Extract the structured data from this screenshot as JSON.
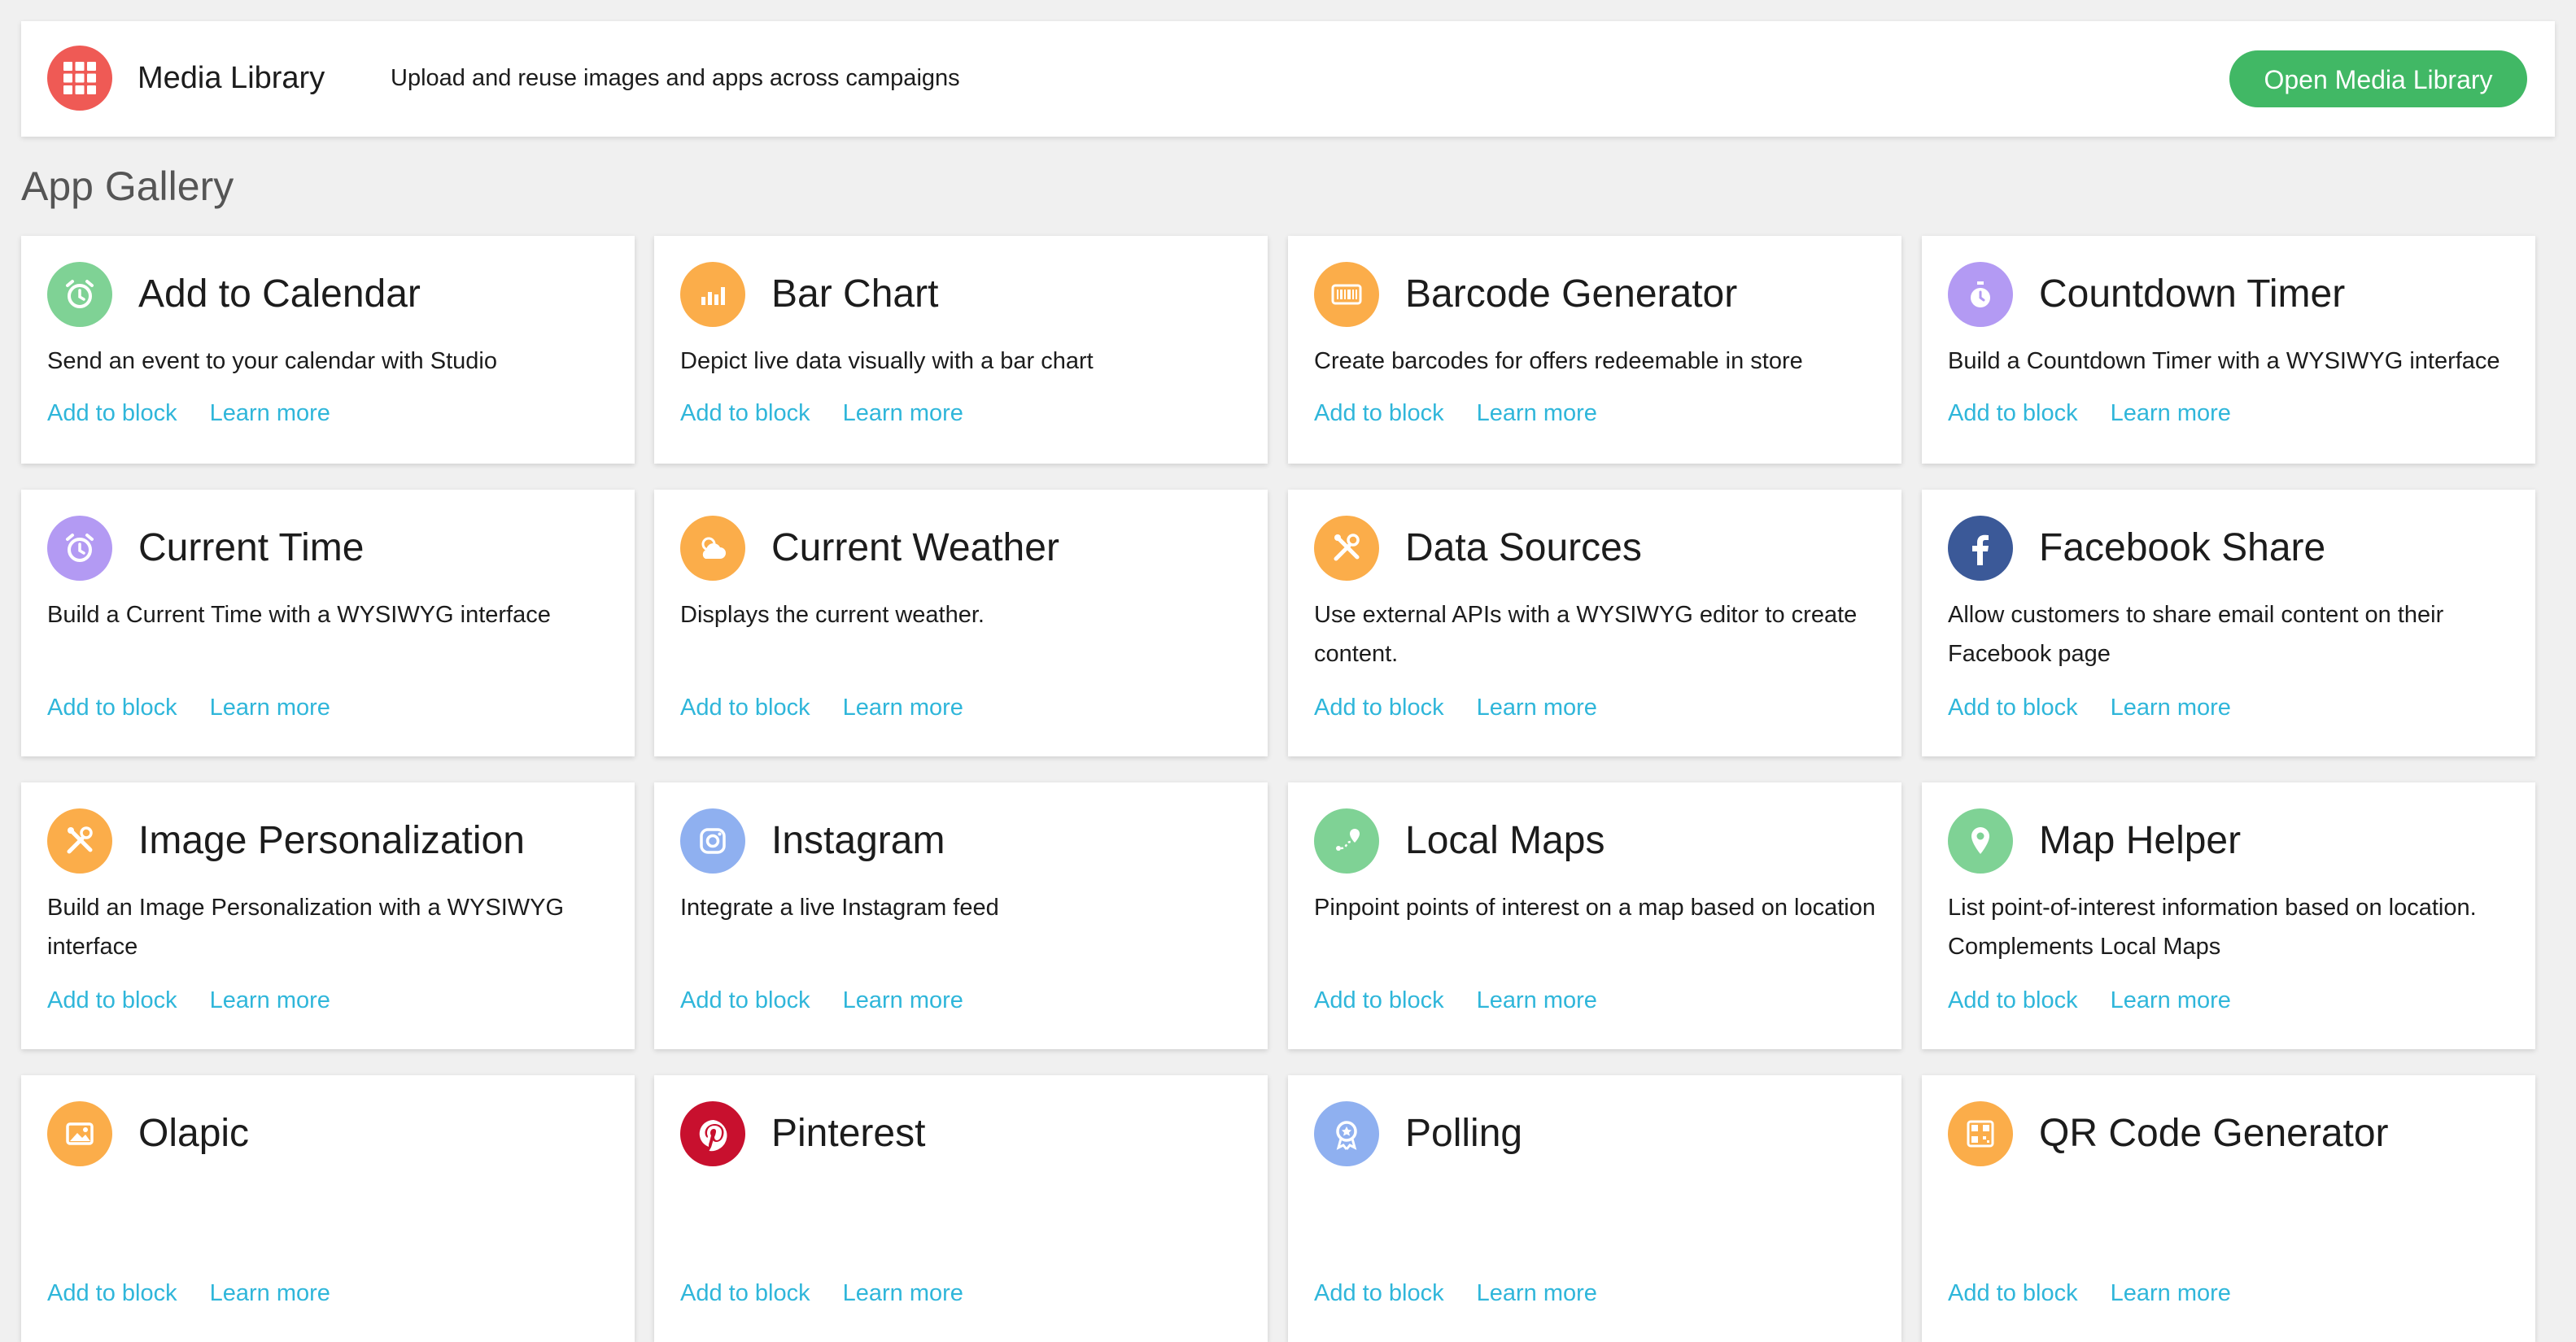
{
  "media_library": {
    "title": "Media Library",
    "description": "Upload and reuse images and apps across campaigns",
    "button": "Open Media Library",
    "icon": "grid-icon",
    "icon_color": "#ef5a55",
    "button_color": "#41b865"
  },
  "gallery": {
    "title": "App Gallery",
    "add_label": "Add to block",
    "learn_label": "Learn more",
    "link_color": "#2fb6da",
    "apps": [
      {
        "title": "Add to Calendar",
        "description": "Send an event to your calendar with Studio",
        "icon": "alarm-clock-icon",
        "color": "#7fd295"
      },
      {
        "title": "Bar Chart",
        "description": "Depict live data visually with a bar chart",
        "icon": "bar-chart-icon",
        "color": "#fbad4a"
      },
      {
        "title": "Barcode Generator",
        "description": "Create barcodes for offers redeemable in store",
        "icon": "barcode-icon",
        "color": "#fbad4a"
      },
      {
        "title": "Countdown Timer",
        "description": "Build a Countdown Timer with a WYSIWYG interface",
        "icon": "stopwatch-icon",
        "color": "#b39af3"
      },
      {
        "title": "Current Time",
        "description": "Build a Current Time with a WYSIWYG interface",
        "icon": "alarm-clock-icon",
        "color": "#b39af3"
      },
      {
        "title": "Current Weather",
        "description": "Displays the current weather.",
        "icon": "weather-icon",
        "color": "#fbad4a"
      },
      {
        "title": "Data Sources",
        "description": "Use external APIs with a WYSIWYG editor to create content.",
        "icon": "tools-icon",
        "color": "#fbad4a"
      },
      {
        "title": "Facebook Share",
        "description": "Allow customers to share email content on their Facebook page",
        "icon": "facebook-icon",
        "color": "#3b5998"
      },
      {
        "title": "Image Personalization",
        "description": "Build an Image Personalization with a WYSIWYG interface",
        "icon": "tools-icon",
        "color": "#fbad4a"
      },
      {
        "title": "Instagram",
        "description": "Integrate a live Instagram feed",
        "icon": "instagram-icon",
        "color": "#8fb0f0"
      },
      {
        "title": "Local Maps",
        "description": "Pinpoint points of interest on a map based on location",
        "icon": "route-icon",
        "color": "#7fd295"
      },
      {
        "title": "Map Helper",
        "description": "List point-of-interest information based on location. Complements Local Maps",
        "icon": "map-pin-icon",
        "color": "#7fd295"
      },
      {
        "title": "Olapic",
        "description": "",
        "icon": "image-icon",
        "color": "#fbad4a"
      },
      {
        "title": "Pinterest",
        "description": "",
        "icon": "pinterest-icon",
        "color": "#c8102e"
      },
      {
        "title": "Polling",
        "description": "",
        "icon": "badge-icon",
        "color": "#8fb0f0"
      },
      {
        "title": "QR Code Generator",
        "description": "",
        "icon": "qr-code-icon",
        "color": "#fbad4a"
      }
    ]
  }
}
